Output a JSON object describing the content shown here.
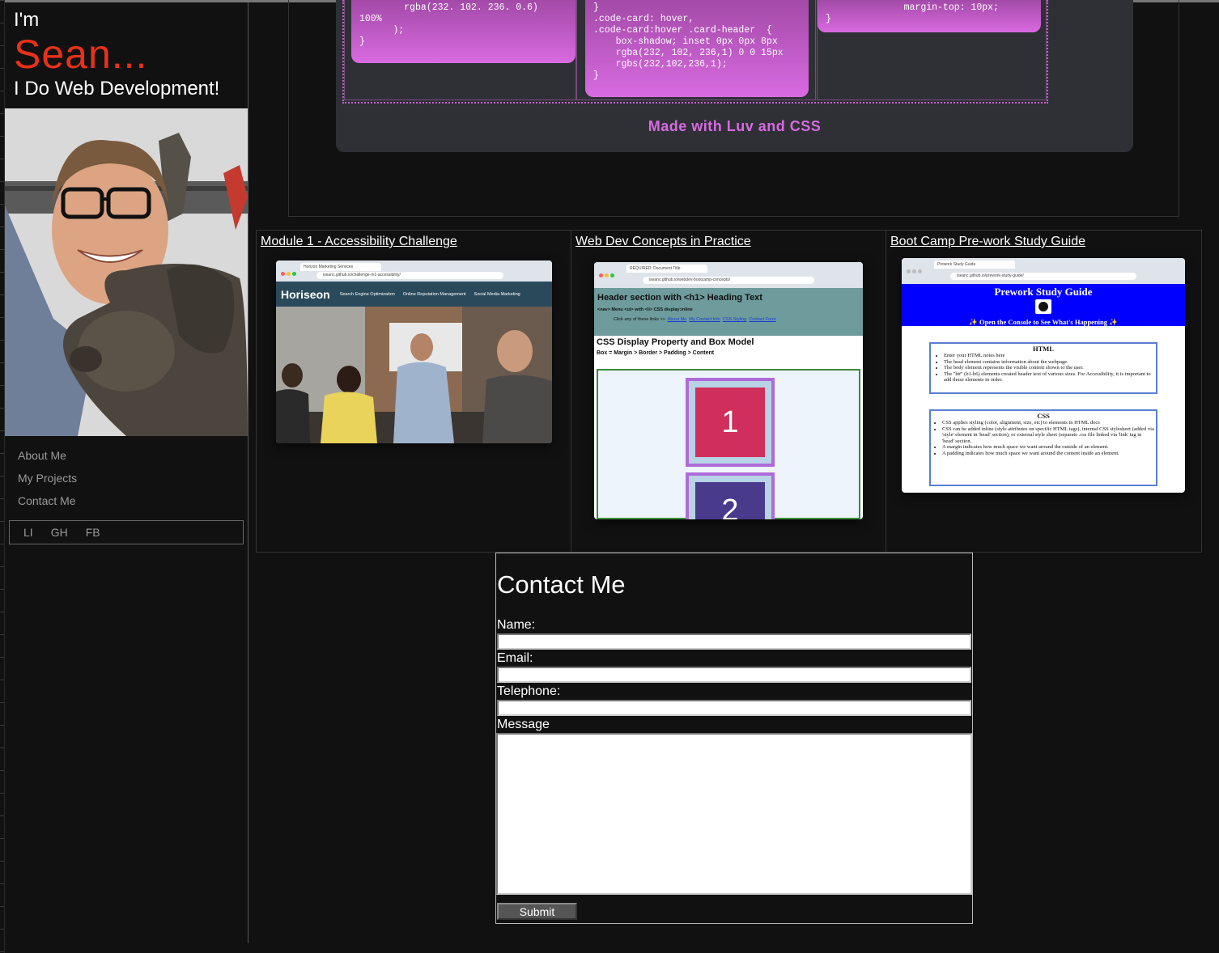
{
  "hero": {
    "im": "I'm",
    "name": "Sean...",
    "tagline": "I Do Web Development!"
  },
  "nav": {
    "items": [
      "About Me",
      "My Projects",
      "Contact Me"
    ]
  },
  "social": {
    "items": [
      "LI",
      "GH",
      "FB"
    ]
  },
  "code_panel": {
    "card1": "        rgba(232. 102. 236. 0.6)\n100%\n      );\n}",
    "card2": "}\n.code-card: hover,\n.code-card:hover .card-header  {\n    box-shadow; inset 0px 0px 8px\n    rgba(232, 102, 236,1) 0 0 15px\n    rgbs(232,102,236,1);\n}",
    "card3": "              margin-top: 10px;\n}",
    "footer": "Made with Luv and CSS"
  },
  "projects": [
    {
      "title": "Module 1 - Accessibility Challenge",
      "tab": "Horizon Marketing Services",
      "url": "iseanc.github.io/challenge-m1-accessibility/",
      "brand": "Horiseon",
      "menu": [
        "Search Engine Optimization",
        "Online Reputation Management",
        "Social Media Marketing"
      ]
    },
    {
      "title": "Web Dev Concepts in Practice",
      "tab": "REQUIRED: Document Title",
      "url": "iseanc.github.io/webdev-bootcamp-concepts/",
      "h1": "Header section with <h1> Heading Text",
      "nav_line": "<nav> Menu <ul> with <li> CSS display:inline",
      "links_prefix": "Click any of these links >>",
      "links": [
        "About Me",
        "My Contact Info",
        "CSS Styling",
        "Contact Form"
      ],
      "h2": "CSS Display Property and Box Model",
      "box_line": "Box = Margin > Border > Padding > Content",
      "box1": "1",
      "box2": "2"
    },
    {
      "title": "Boot Camp Pre-work Study Guide",
      "tab": "Prework Study Guide",
      "url": "iseanc.github.io/prework-study-guide/",
      "heading": "Prework Study Guide",
      "subheading": "✨ Open the Console to See What's Happening ✨",
      "html_title": "HTML",
      "html_items": [
        "Enter your HTML notes here",
        "The head element contains information about the webpage.",
        "The body element represents the visible content shown to the user.",
        "The \"h#\" (h1-h6) elements created header text of various sizes. For Accessibility, it is important to add those elements in order."
      ],
      "css_title": "CSS",
      "css_items": [
        "CSS applies styling (color, alignment, size, etc) to elements in HTML docs",
        "CSS can be added inline (style attributes on specific HTML tags), internal CSS stylesheet (added via 'style' element in 'head' section), or external style sheet (separate .css file linked via 'link' tag in 'head' section.",
        "A margin indicates how much space we want around the outside of an element.",
        "A padding indicates how much space we want around the content inside an element."
      ]
    }
  ],
  "contact": {
    "title": "Contact Me",
    "name_label": "Name:",
    "email_label": "Email:",
    "phone_label": "Telephone:",
    "message_label": "Message",
    "submit": "Submit"
  },
  "colors": {
    "accent_red": "#e8311a",
    "code_pink": "#d86ae0",
    "background": "#111111"
  }
}
